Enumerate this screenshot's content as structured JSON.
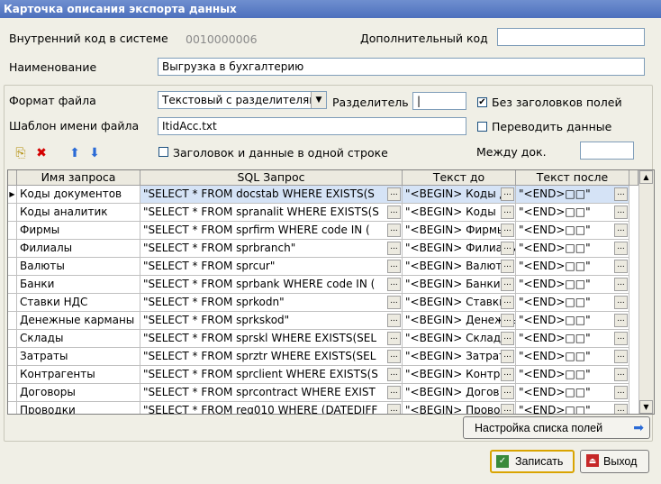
{
  "window": {
    "title": "Карточка описания экспорта данных"
  },
  "header": {
    "internal_code_label": "Внутренний код в системе",
    "internal_code_value": "0010000006",
    "additional_code_label": "Дополнительный код",
    "additional_code_value": "",
    "name_label": "Наименование",
    "name_value": "Выгрузка  в бухгалтерию"
  },
  "format": {
    "file_format_label": "Формат файла",
    "file_format_value": "Текстовый с разделителям",
    "separator_label": "Разделитель",
    "separator_value": "|",
    "template_label": "Шаблон имени файла",
    "template_value": "ItidAcc.txt",
    "no_headers_label": "Без заголовков полей",
    "no_headers_checked": "✔",
    "translate_label": "Переводить данные",
    "same_line_label": "Заголовок и данные в одной строке",
    "between_docs_label": "Между док.",
    "between_docs_value": ""
  },
  "table": {
    "columns": [
      "Имя запроса",
      "SQL Запрос",
      "Текст до",
      "Текст после"
    ],
    "rows": [
      {
        "name": "Коды документов",
        "sql": "\"SELECT * FROM docstab WHERE EXISTS(S",
        "before": "\"<BEGIN> Коды д",
        "after": "\"<END>□□\""
      },
      {
        "name": "Коды аналитик",
        "sql": "\"SELECT * FROM spranalit WHERE EXISTS(S",
        "before": "\"<BEGIN> Коды",
        "after": "\"<END>□□\""
      },
      {
        "name": "Фирмы",
        "sql": "\"SELECT * FROM sprfirm  WHERE code  IN (",
        "before": "\"<BEGIN> Фирмы",
        "after": "\"<END>□□\""
      },
      {
        "name": "Филиалы",
        "sql": "\"SELECT * FROM sprbranch\"",
        "before": "\"<BEGIN> Филиалы",
        "after": "\"<END>□□\""
      },
      {
        "name": "Валюты",
        "sql": "\"SELECT * FROM sprcur\"",
        "before": "\"<BEGIN> Валюты",
        "after": "\"<END>□□\""
      },
      {
        "name": "Банки",
        "sql": "\"SELECT * FROM sprbank WHERE code IN (",
        "before": "\"<BEGIN> Банки",
        "after": "\"<END>□□\""
      },
      {
        "name": "Ставки НДС",
        "sql": "\"SELECT * FROM sprkodn\"",
        "before": "\"<BEGIN> Ставки",
        "after": "\"<END>□□\""
      },
      {
        "name": "Денежные карманы",
        "sql": "\"SELECT * FROM sprkskod\"",
        "before": "\"<BEGIN> Денежные",
        "after": "\"<END>□□\""
      },
      {
        "name": "Склады",
        "sql": "\"SELECT * FROM sprskl WHERE EXISTS(SEL",
        "before": "\"<BEGIN> Склады",
        "after": "\"<END>□□\""
      },
      {
        "name": "Затраты",
        "sql": "\"SELECT * FROM sprztr WHERE EXISTS(SEL",
        "before": "\"<BEGIN> Затраты",
        "after": "\"<END>□□\""
      },
      {
        "name": "Контрагенты",
        "sql": "\"SELECT * FROM sprclient WHERE EXISTS(S",
        "before": "\"<BEGIN> Контр",
        "after": "\"<END>□□\""
      },
      {
        "name": "Договоры",
        "sql": "\"SELECT * FROM sprcontract WHERE EXIST",
        "before": "\"<BEGIN> Догов",
        "after": "\"<END>□□\""
      },
      {
        "name": "Проводки",
        "sql": "\"SELECT * FROM reg010 WHERE (DATEDIFF",
        "before": "\"<BEGIN> Прово",
        "after": "\"<END>□□\""
      }
    ]
  },
  "buttons": {
    "fields_setup": "Настройка списка полей",
    "save": "Записать",
    "exit": "Выход",
    "ellipsis": "..."
  },
  "colors": {
    "title_bar": "#4d70bd",
    "selected_row": "#d5e3f6"
  }
}
